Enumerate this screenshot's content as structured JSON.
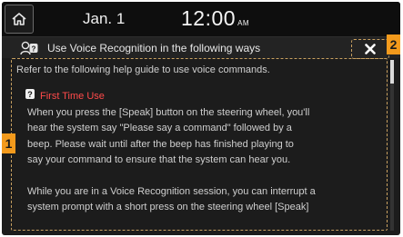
{
  "status_bar": {
    "date": "Jan.  1",
    "time": "12:00",
    "ampm": "AM"
  },
  "dialog": {
    "title": "Use Voice Recognition in the following ways"
  },
  "content": {
    "intro": "Refer to the following help guide to use voice commands.",
    "section_title": "First Time Use",
    "paragraph_lines": [
      "When you press the [Speak] button on the steering wheel, you'll",
      "hear the system say \"Please say a command\" followed by a",
      "beep. Please wait until after the beep has finished playing to",
      "say your command to ensure that the system can hear you."
    ],
    "paragraph2_lines": [
      "While you are in a Voice Recognition session, you can interrupt a",
      "system prompt with a short press on the steering wheel [Speak]"
    ]
  },
  "callouts": {
    "content_label": "1",
    "close_label": "2"
  },
  "icons": [
    "home-icon",
    "voice-recognition-icon",
    "close-icon",
    "help-icon"
  ],
  "colors": {
    "section_title": "#ff4a4a",
    "callout": "#f39a1c"
  }
}
